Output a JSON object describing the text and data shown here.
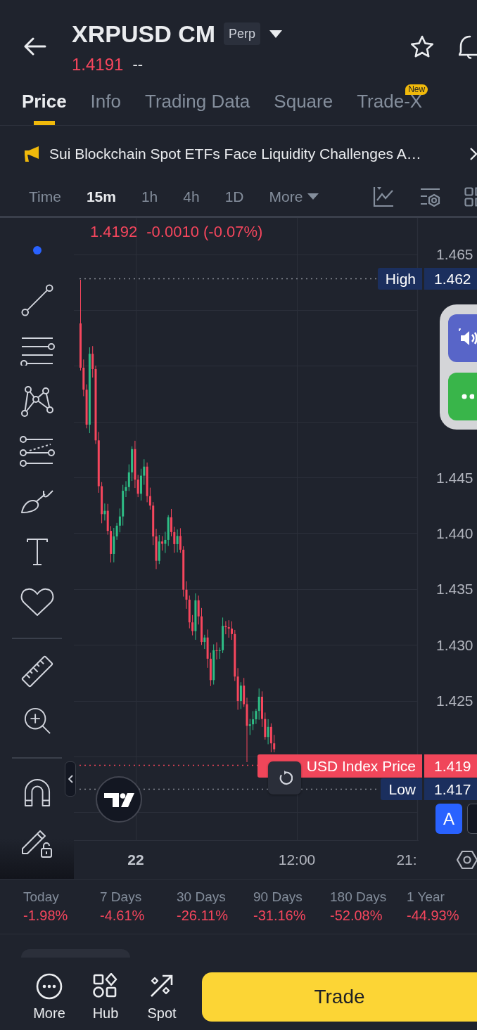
{
  "header": {
    "title": "XRPUSD CM",
    "badge": "Perp",
    "price": "1.4191",
    "change": "--"
  },
  "tabs": [
    {
      "label": "Price",
      "selected": true
    },
    {
      "label": "Info",
      "selected": false
    },
    {
      "label": "Trading Data",
      "selected": false
    },
    {
      "label": "Square",
      "selected": false
    },
    {
      "label": "Trade-X",
      "selected": false,
      "badge": "New"
    }
  ],
  "news": {
    "headline": "Sui Blockchain Spot ETFs Face Liquidity Challenges A…"
  },
  "intervals": [
    {
      "label": "Time",
      "selected": false,
      "dropdown": false
    },
    {
      "label": "15m",
      "selected": true,
      "dropdown": false
    },
    {
      "label": "1h",
      "selected": false,
      "dropdown": false
    },
    {
      "label": "4h",
      "selected": false,
      "dropdown": false
    },
    {
      "label": "1D",
      "selected": false,
      "dropdown": false
    },
    {
      "label": "More",
      "selected": false,
      "dropdown": true
    }
  ],
  "chart": {
    "legend": {
      "price": "1.4192",
      "change": "-0.0010 (-0.07%)"
    },
    "price_ticks": [
      "1.465",
      "1.445",
      "1.440",
      "1.435",
      "1.430",
      "1.425"
    ],
    "markers": [
      {
        "kind": "high",
        "label": "High",
        "value": "1.462"
      },
      {
        "kind": "index",
        "label": "USD Index Price",
        "value": "1.419"
      },
      {
        "kind": "low",
        "label": "Low",
        "value": "1.417"
      }
    ],
    "time_ticks": [
      {
        "label": "22",
        "kind": "date"
      },
      {
        "label": "12:00",
        "kind": "time"
      },
      {
        "label": "21:",
        "kind": "time"
      }
    ],
    "scale_button": "A"
  },
  "stats": [
    {
      "period": "Today",
      "change": "-1.98%"
    },
    {
      "period": "7 Days",
      "change": "-4.61%"
    },
    {
      "period": "30 Days",
      "change": "-26.11%"
    },
    {
      "period": "90 Days",
      "change": "-31.16%"
    },
    {
      "period": "180 Days",
      "change": "-52.08%"
    },
    {
      "period": "1 Year",
      "change": "-44.93%"
    }
  ],
  "bottom_nav": [
    {
      "label": "More",
      "kind": "more"
    },
    {
      "label": "Hub",
      "kind": "hub"
    },
    {
      "label": "Spot",
      "kind": "spot"
    }
  ],
  "trade_button": "Trade"
}
